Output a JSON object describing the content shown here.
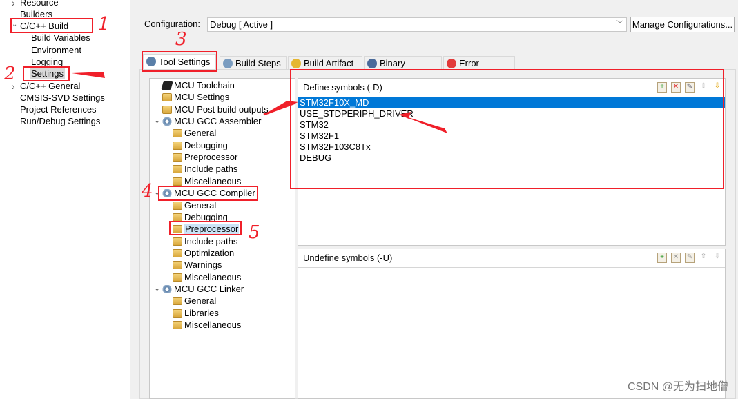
{
  "left_nav": {
    "items": [
      {
        "label": "Resource",
        "level": 0,
        "arrow": "›"
      },
      {
        "label": "Builders",
        "level": 0
      },
      {
        "label": "C/C++ Build",
        "level": 0,
        "arrow": "✓"
      },
      {
        "label": "Build Variables",
        "level": 1
      },
      {
        "label": "Environment",
        "level": 1
      },
      {
        "label": "Logging",
        "level": 1
      },
      {
        "label": "Settings",
        "level": 1,
        "selected": true
      },
      {
        "label": "C/C++ General",
        "level": 0,
        "arrow": "›"
      },
      {
        "label": "CMSIS-SVD Settings",
        "level": 0
      },
      {
        "label": "Project References",
        "level": 0
      },
      {
        "label": "Run/Debug Settings",
        "level": 0
      }
    ]
  },
  "configuration": {
    "label": "Configuration:",
    "value": "Debug  [ Active ]",
    "manage_label": "Manage Configurations..."
  },
  "tabs": [
    {
      "label": "Tool Settings",
      "selected": true,
      "icon": "tool-settings-icon",
      "color": "#5a7fa8"
    },
    {
      "label": "Build Steps",
      "icon": "build-steps-icon",
      "color": "#7a9cc0"
    },
    {
      "label": "Build Artifact",
      "icon": "trophy-icon",
      "color": "#e5b630"
    },
    {
      "label": "Binary Parsers",
      "icon": "binary-file-icon",
      "color": "#4a6a9a"
    },
    {
      "label": "Error Parsers",
      "icon": "error-icon",
      "color": "#e23a3a"
    }
  ],
  "tool_tree": [
    {
      "label": "MCU Toolchain",
      "level": 0,
      "icon": "chip"
    },
    {
      "label": "MCU Settings",
      "level": 0,
      "icon": "folder"
    },
    {
      "label": "MCU Post build outputs",
      "level": 0,
      "icon": "folder"
    },
    {
      "label": "MCU GCC Assembler",
      "level": 0,
      "icon": "gear",
      "expanded": true
    },
    {
      "label": "General",
      "level": 1,
      "icon": "folder"
    },
    {
      "label": "Debugging",
      "level": 1,
      "icon": "folder"
    },
    {
      "label": "Preprocessor",
      "level": 1,
      "icon": "folder"
    },
    {
      "label": "Include paths",
      "level": 1,
      "icon": "folder"
    },
    {
      "label": "Miscellaneous",
      "level": 1,
      "icon": "folder"
    },
    {
      "label": "MCU GCC Compiler",
      "level": 0,
      "icon": "gear",
      "expanded": true
    },
    {
      "label": "General",
      "level": 1,
      "icon": "folder"
    },
    {
      "label": "Debugging",
      "level": 1,
      "icon": "folder"
    },
    {
      "label": "Preprocessor",
      "level": 1,
      "icon": "folder",
      "selected": true
    },
    {
      "label": "Include paths",
      "level": 1,
      "icon": "folder"
    },
    {
      "label": "Optimization",
      "level": 1,
      "icon": "folder"
    },
    {
      "label": "Warnings",
      "level": 1,
      "icon": "folder"
    },
    {
      "label": "Miscellaneous",
      "level": 1,
      "icon": "folder"
    },
    {
      "label": "MCU GCC Linker",
      "level": 0,
      "icon": "gear",
      "expanded": true
    },
    {
      "label": "General",
      "level": 1,
      "icon": "folder"
    },
    {
      "label": "Libraries",
      "level": 1,
      "icon": "folder"
    },
    {
      "label": "Miscellaneous",
      "level": 1,
      "icon": "folder"
    }
  ],
  "define_symbols": {
    "title": "Define symbols (-D)",
    "items": [
      "STM32F10X_MD",
      "USE_STDPERIPH_DRIVER",
      "STM32",
      "STM32F1",
      "STM32F103C8Tx",
      "DEBUG"
    ],
    "selected_index": 0
  },
  "undefine_symbols": {
    "title": "Undefine symbols (-U)",
    "items": []
  },
  "annotations": {
    "numbers": [
      "1",
      "2",
      "3",
      "4",
      "5"
    ],
    "color": "#f0202a"
  },
  "watermark": "CSDN @无为扫地僧"
}
